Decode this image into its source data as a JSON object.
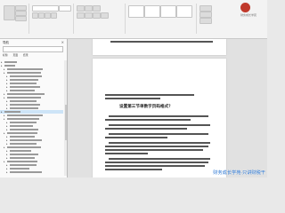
{
  "sidebar": {
    "title": "导航",
    "tabs": [
      "标题",
      "页面",
      "结果"
    ],
    "close_glyph": "×"
  },
  "document": {
    "heading": "设置第三节单数字页码格式？",
    "watermark": "财务成长学苑·只讲财税干"
  },
  "brand": {
    "logo_text": "财务成长学苑"
  },
  "colors": {
    "accent": "#1f6fd1",
    "selection": "#cde4f7",
    "logo": "#c0392b"
  }
}
